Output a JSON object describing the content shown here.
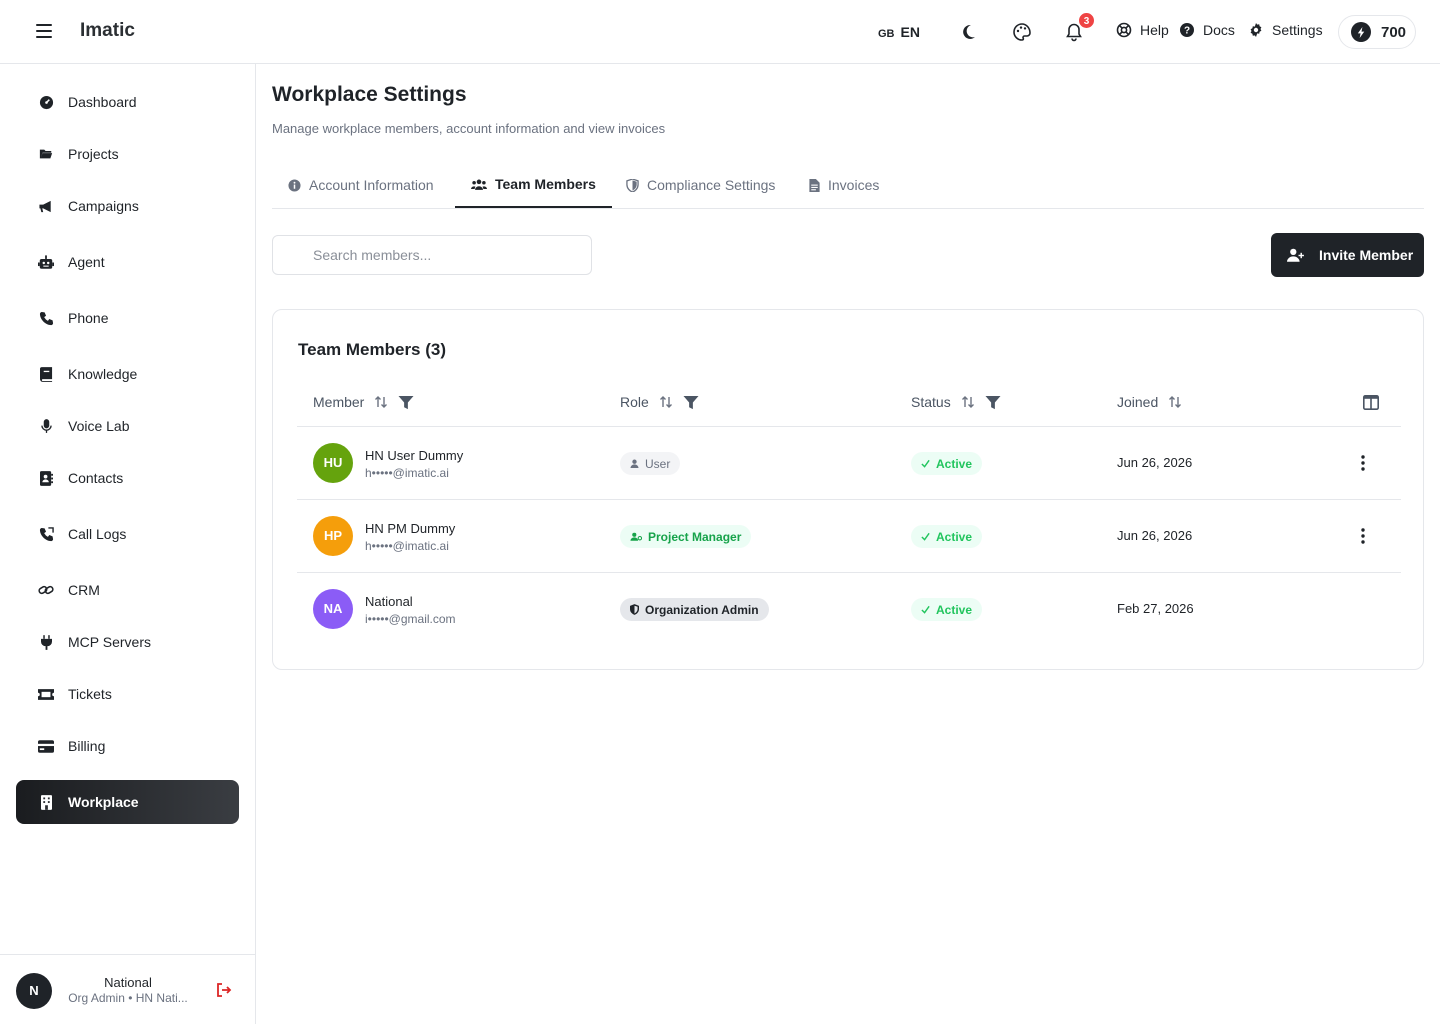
{
  "app": {
    "brand": "Imatic",
    "lang_flag": "GB",
    "lang_code": "EN",
    "notifications_count": "3",
    "help_label": "Help",
    "docs_label": "Docs",
    "settings_label": "Settings",
    "credits": "700"
  },
  "sidebar": {
    "items": [
      {
        "label": "Dashboard",
        "icon": "dashboard-icon"
      },
      {
        "label": "Projects",
        "icon": "folder-icon"
      },
      {
        "label": "Campaigns",
        "icon": "megaphone-icon"
      },
      {
        "label": "Agent",
        "icon": "robot-icon"
      },
      {
        "label": "Phone",
        "icon": "phone-icon"
      },
      {
        "label": "Knowledge",
        "icon": "book-icon"
      },
      {
        "label": "Voice Lab",
        "icon": "microphone-icon"
      },
      {
        "label": "Contacts",
        "icon": "contacts-icon"
      },
      {
        "label": "Call Logs",
        "icon": "call-log-icon"
      },
      {
        "label": "CRM",
        "icon": "link-icon"
      },
      {
        "label": "MCP Servers",
        "icon": "plug-icon"
      },
      {
        "label": "Tickets",
        "icon": "ticket-icon"
      },
      {
        "label": "Billing",
        "icon": "credit-card-icon"
      },
      {
        "label": "Workplace",
        "icon": "building-icon",
        "active": true
      }
    ],
    "user": {
      "initial": "N",
      "name": "National",
      "role": "Org Admin • HN Nati..."
    }
  },
  "page": {
    "title": "Workplace Settings",
    "subtitle": "Manage workplace members, account information and view invoices",
    "tabs": [
      {
        "label": "Account Information",
        "active": false
      },
      {
        "label": "Team Members",
        "active": true
      },
      {
        "label": "Compliance Settings",
        "active": false
      },
      {
        "label": "Invoices",
        "active": false
      }
    ],
    "search_placeholder": "Search members...",
    "invite_label": "Invite Member"
  },
  "members": {
    "title": "Team Members (3)",
    "columns": [
      "Member",
      "Role",
      "Status",
      "Joined"
    ],
    "rows": [
      {
        "initials": "HU",
        "avatar_color": "#65a30d",
        "name": "HN User Dummy",
        "email": "h•••••@imatic.ai",
        "role": "User",
        "status": "Active",
        "joined": "Jun 26, 2026"
      },
      {
        "initials": "HP",
        "avatar_color": "#f59e0b",
        "name": "HN PM Dummy",
        "email": "h•••••@imatic.ai",
        "role": "Project Manager",
        "status": "Active",
        "joined": "Jun 26, 2026"
      },
      {
        "initials": "NA",
        "avatar_color": "#8b5cf6",
        "name": "National",
        "email": "i•••••@gmail.com",
        "role": "Organization Admin",
        "status": "Active",
        "joined": "Feb 27, 2026"
      }
    ]
  }
}
